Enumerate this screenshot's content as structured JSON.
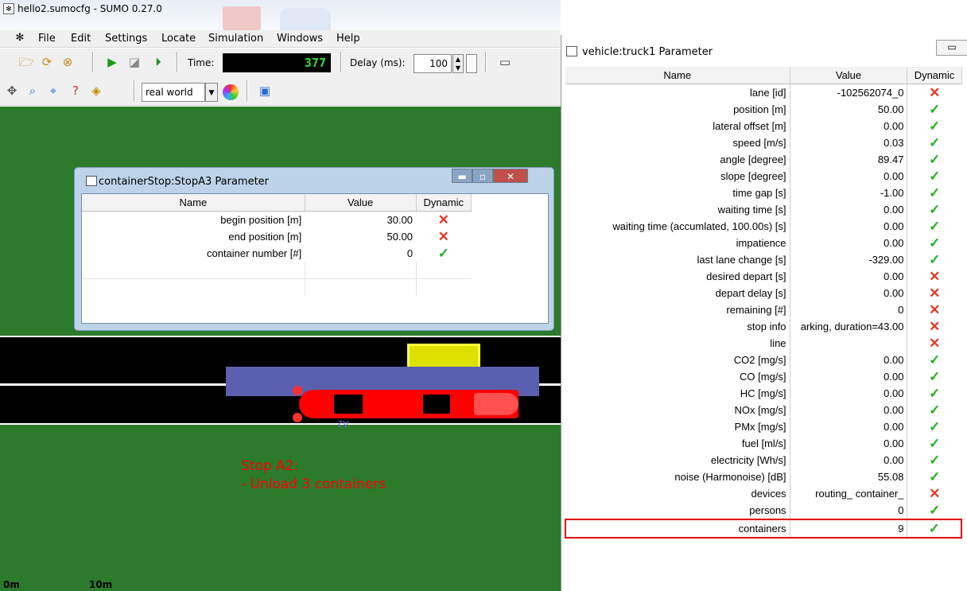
{
  "window": {
    "title": "hello2.sumocfg - SUMO 0.27.0"
  },
  "menu": [
    "File",
    "Edit",
    "Settings",
    "Locate",
    "Simulation",
    "Windows",
    "Help"
  ],
  "toolbar": {
    "time_label": "Time:",
    "time_value": "377",
    "delay_label": "Delay (ms):",
    "delay_value": "100",
    "scheme_value": "real world"
  },
  "canvas": {
    "annotation_line1": "Stop A2:",
    "annotation_line2": "- Unload 3 containers",
    "scale_0": "0m",
    "scale_10": "10m",
    "road_label": "A2",
    "colors": {
      "grass": "#2c7a2c",
      "road": "#000000",
      "stop": "#5b5fb0",
      "truck": "#ff0000",
      "container_stop": "#e0e000",
      "annotation": "#ff0000"
    }
  },
  "stop_dialog": {
    "title": "containerStop:StopA3 Parameter",
    "headers": [
      "Name",
      "Value",
      "Dynamic"
    ],
    "rows": [
      {
        "name": "begin position [m]",
        "value": "30.00",
        "dynamic": "no"
      },
      {
        "name": "end position [m]",
        "value": "50.00",
        "dynamic": "no"
      },
      {
        "name": "container number [#]",
        "value": "0",
        "dynamic": "yes"
      }
    ]
  },
  "vehicle_dialog": {
    "title": "vehicle:truck1 Parameter",
    "headers": [
      "Name",
      "Value",
      "Dynamic"
    ],
    "rows": [
      {
        "name": "lane [id]",
        "value": "-102562074_0",
        "dynamic": "no"
      },
      {
        "name": "position [m]",
        "value": "50.00",
        "dynamic": "yes"
      },
      {
        "name": "lateral offset [m]",
        "value": "0.00",
        "dynamic": "yes"
      },
      {
        "name": "speed [m/s]",
        "value": "0.03",
        "dynamic": "yes"
      },
      {
        "name": "angle [degree]",
        "value": "89.47",
        "dynamic": "yes"
      },
      {
        "name": "slope [degree]",
        "value": "0.00",
        "dynamic": "yes"
      },
      {
        "name": "time gap [s]",
        "value": "-1.00",
        "dynamic": "yes"
      },
      {
        "name": "waiting time [s]",
        "value": "0.00",
        "dynamic": "yes"
      },
      {
        "name": "waiting time (accumlated, 100.00s) [s]",
        "value": "0.00",
        "dynamic": "yes"
      },
      {
        "name": "impatience",
        "value": "0.00",
        "dynamic": "yes"
      },
      {
        "name": "last lane change [s]",
        "value": "-329.00",
        "dynamic": "yes"
      },
      {
        "name": "desired depart [s]",
        "value": "0.00",
        "dynamic": "no"
      },
      {
        "name": "depart delay [s]",
        "value": "0.00",
        "dynamic": "no"
      },
      {
        "name": "remaining [#]",
        "value": "0",
        "dynamic": "no"
      },
      {
        "name": "stop info",
        "value": "arking, duration=43.00",
        "dynamic": "no"
      },
      {
        "name": "line",
        "value": "",
        "dynamic": "no"
      },
      {
        "name": "CO2 [mg/s]",
        "value": "0.00",
        "dynamic": "yes"
      },
      {
        "name": "CO [mg/s]",
        "value": "0.00",
        "dynamic": "yes"
      },
      {
        "name": "HC [mg/s]",
        "value": "0.00",
        "dynamic": "yes"
      },
      {
        "name": "NOx [mg/s]",
        "value": "0.00",
        "dynamic": "yes"
      },
      {
        "name": "PMx [mg/s]",
        "value": "0.00",
        "dynamic": "yes"
      },
      {
        "name": "fuel [ml/s]",
        "value": "0.00",
        "dynamic": "yes"
      },
      {
        "name": "electricity [Wh/s]",
        "value": "0.00",
        "dynamic": "yes"
      },
      {
        "name": "noise (Harmonoise) [dB]",
        "value": "55.08",
        "dynamic": "yes"
      },
      {
        "name": "devices",
        "value": "routing_ container_",
        "dynamic": "no"
      },
      {
        "name": "persons",
        "value": "0",
        "dynamic": "yes"
      },
      {
        "name": "containers",
        "value": "9",
        "dynamic": "yes",
        "highlighted": true
      }
    ]
  }
}
